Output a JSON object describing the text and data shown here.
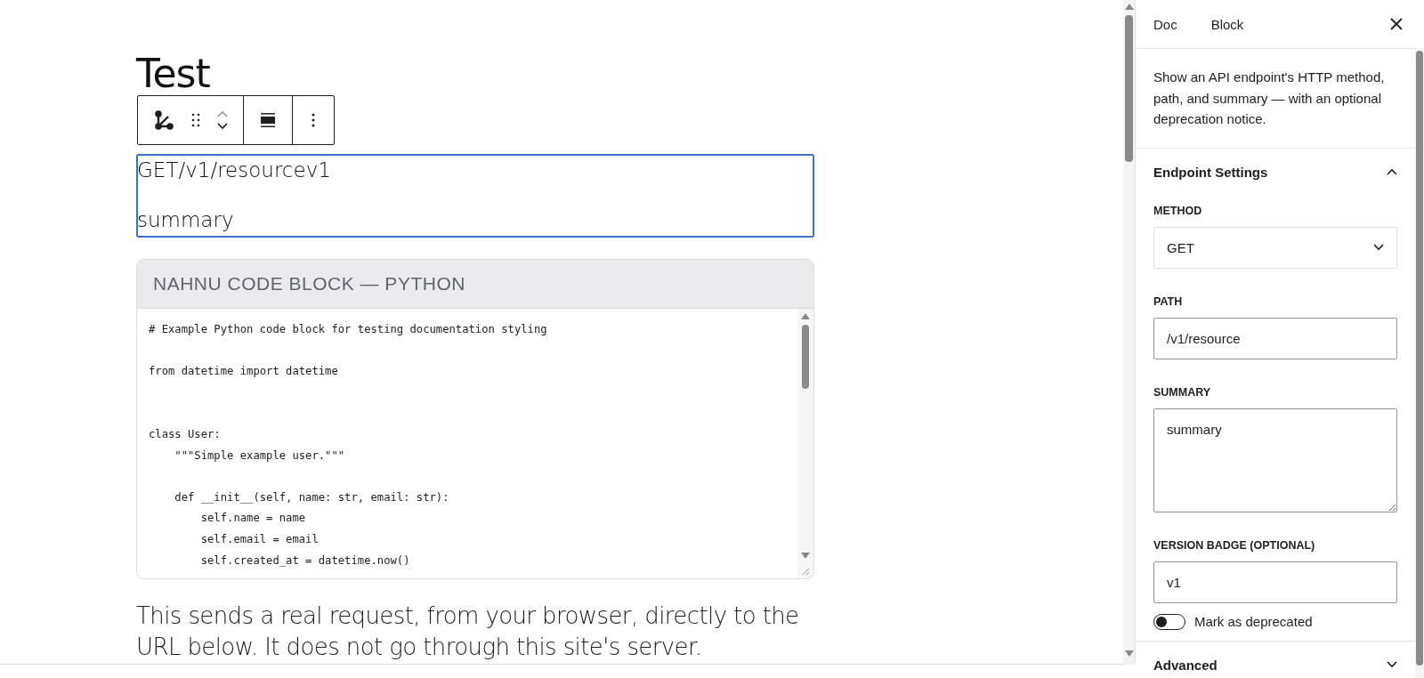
{
  "editor": {
    "title": "Test",
    "endpoint_block": {
      "heading": "GET/v1/resourcev1",
      "summary": "summary"
    },
    "code_block": {
      "header": "NAHNU CODE BLOCK — PYTHON",
      "code": "# Example Python code block for testing documentation styling\n\nfrom datetime import datetime\n\n\nclass User:\n    \"\"\"Simple example user.\"\"\"\n\n    def __init__(self, name: str, email: str):\n        self.name = name\n        self.email = email\n        self.created_at = datetime.now()"
    },
    "paragraph": "This sends a real request, from your browser, directly to the URL below. It does not go through this site's server."
  },
  "sidebar": {
    "tabs": [
      {
        "label": "Doc"
      },
      {
        "label": "Block"
      }
    ],
    "description": "Show an API endpoint's HTTP method, path, and summary — with an optional deprecation notice.",
    "panels": [
      {
        "title": "Endpoint Settings",
        "expanded": true,
        "fields": [
          {
            "kind": "select",
            "label": "METHOD",
            "value": "GET"
          },
          {
            "kind": "input",
            "label": "PATH",
            "value": "/v1/resource"
          },
          {
            "kind": "textarea",
            "label": "SUMMARY",
            "value": "summary"
          },
          {
            "kind": "input",
            "label": "VERSION BADGE (OPTIONAL)",
            "value": "v1"
          },
          {
            "kind": "toggle",
            "label": "Mark as deprecated",
            "on": false
          }
        ]
      },
      {
        "title": "Advanced",
        "expanded": false
      }
    ]
  }
}
